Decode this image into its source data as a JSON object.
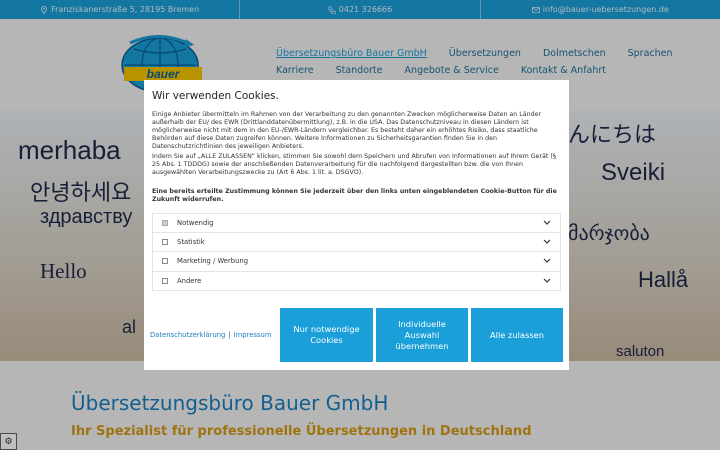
{
  "topbar": {
    "address": "Franziskanerstraße 5, 28195 Bremen",
    "phone": "0421 326666",
    "email": "info@bauer-uebersetzungen.de"
  },
  "logo": {
    "text": "bauer"
  },
  "nav": {
    "row1": [
      "Übersetzungsbüro Bauer GmbH",
      "Übersetzungen",
      "Dolmetschen",
      "Sprachen"
    ],
    "row2": [
      "Karriere",
      "Standorte",
      "Angebote & Service",
      "Kontakt & Anfahrt"
    ]
  },
  "hero": {
    "words": [
      "merhaba",
      "안녕하세요",
      "здравству",
      "Hello",
      "んにちは",
      "Sveiki",
      "მარჯობა",
      "Hallå",
      "saluton",
      "al"
    ]
  },
  "page": {
    "title": "Übersetzungsbüro Bauer GmbH",
    "subtitle": "Ihr Spezialist für professionelle Übersetzungen in Deutschland"
  },
  "cookie": {
    "title": "Wir verwenden Cookies.",
    "para1": "Einige Anbieter übermitteln im Rahmen von der Verarbeitung zu den genannten Zwecken möglicherweise Daten an Länder außerhalb der EU/ des EWR (Drittlanddatenübermittlung), z.B. in die USA. Das Datenschutzniveau in diesen Ländern ist möglicherweise nicht mit dem in den EU-/EWR-Ländern vergleichbar. Es besteht daher ein erhöhtes Risiko, dass staatliche Behörden auf diese Daten zugreifen können. Weitere Informationen zu Sicherheitsgarantien finden Sie in den Datenschutzrichtlinien des jeweiligen Anbieters.",
    "para2": "Indem Sie auf „ALLE ZULASSEN“ klicken, stimmen Sie sowohl dem Speichern und Abrufen von Informationen auf Ihrem Gerät (§ 25 Abs. 1 TDDDG) sowie der anschließenden Datenverarbeitung für die nachfolgend dargestellten bzw. die von Ihnen ausgewählten Verarbeitungszwecke zu (Art 6 Abs. 1 lit. a. DSGVO).",
    "para3": "Eine bereits erteilte Zustimmung können Sie jederzeit über den links unten eingeblendeten Cookie-Button für die Zukunft widerrufen.",
    "categories": [
      "Notwendig",
      "Statistik",
      "Marketing / Werbung",
      "Andere"
    ],
    "privacy_link": "Datenschutzerklärung",
    "imprint_link": "Impressum",
    "btn_necessary": "Nur notwendige Cookies",
    "btn_individual": "Individuelle Auswahl übernehmen",
    "btn_all": "Alle zulassen"
  }
}
